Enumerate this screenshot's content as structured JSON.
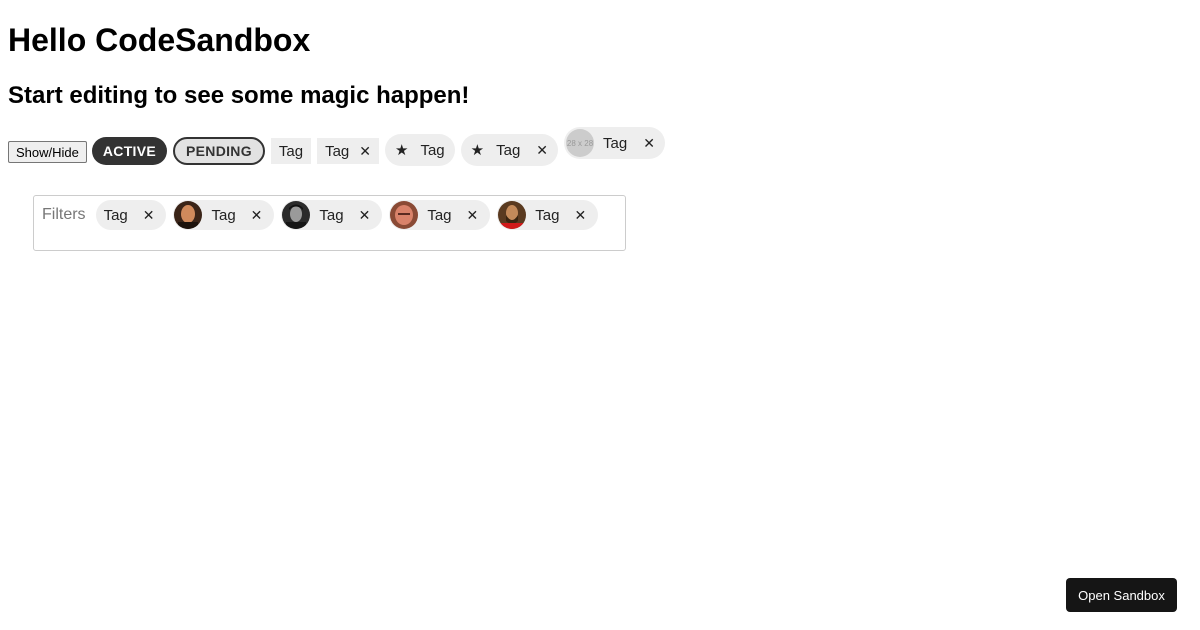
{
  "header": {
    "title": "Hello CodeSandbox",
    "subtitle": "Start editing to see some magic happen!"
  },
  "tag_row": {
    "show_hide_label": "Show/Hide",
    "active_label": "ACTIVE",
    "pending_label": "PENDING",
    "plain_tag_label": "Tag",
    "closable_tag_label": "Tag",
    "star_tag_label": "Tag",
    "star_closable_tag_label": "Tag",
    "avatar_tag_label": "Tag",
    "avatar_placeholder_text": "28 x 28",
    "close_glyph": "✕",
    "star_glyph": "★"
  },
  "filters": {
    "label": "Filters",
    "chips": [
      {
        "label": "Tag",
        "avatar": "none"
      },
      {
        "label": "Tag",
        "avatar": "avatar-portrait-1"
      },
      {
        "label": "Tag",
        "avatar": "avatar-portrait-2"
      },
      {
        "label": "Tag",
        "avatar": "avatar-portrait-3"
      },
      {
        "label": "Tag",
        "avatar": "avatar-portrait-4"
      }
    ]
  },
  "footer": {
    "open_sandbox_label": "Open Sandbox"
  },
  "colors": {
    "active_pill": "#333333",
    "tag_background": "#eeeeee",
    "filter_border": "#cccccc",
    "open_sandbox_button": "#151515"
  }
}
